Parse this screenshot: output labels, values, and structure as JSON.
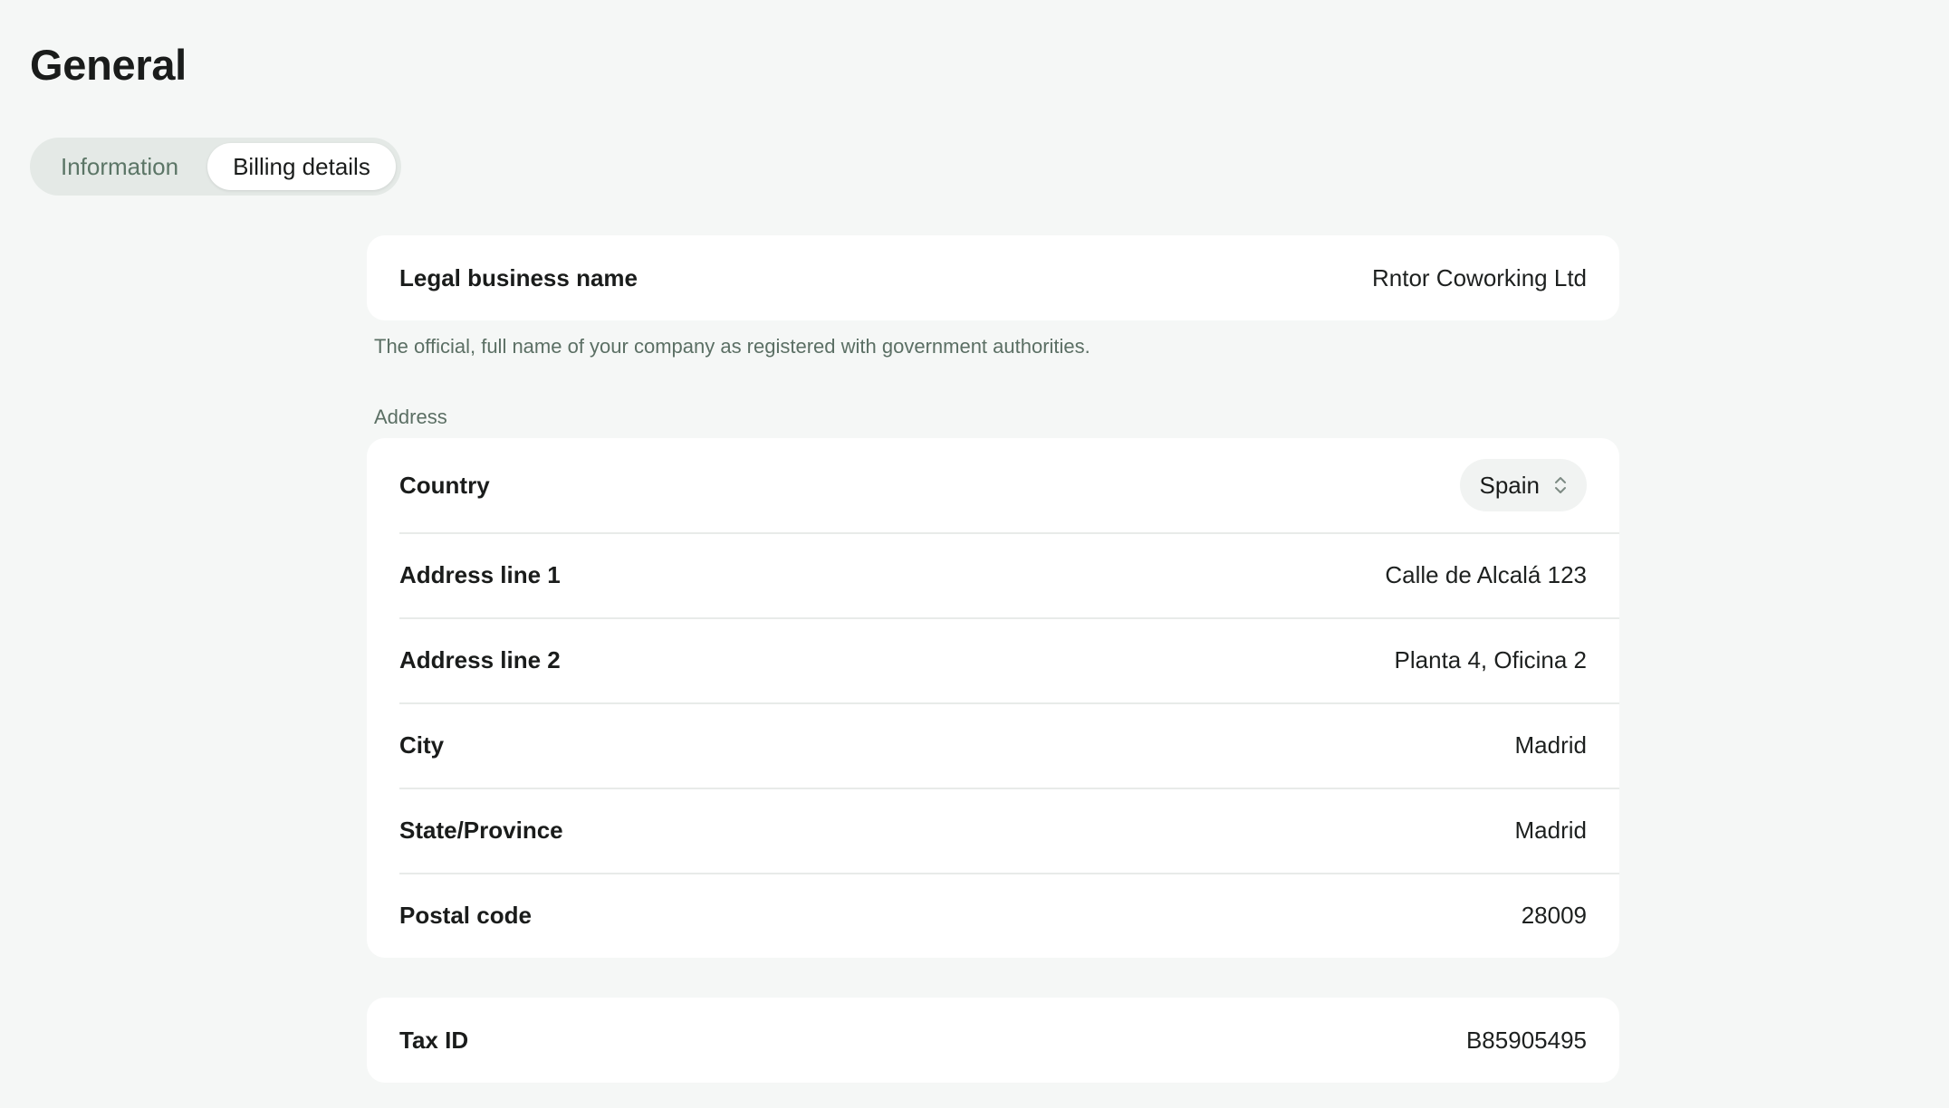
{
  "page": {
    "title": "General"
  },
  "tabs": [
    {
      "label": "Information",
      "active": false
    },
    {
      "label": "Billing details",
      "active": true
    }
  ],
  "legal": {
    "label": "Legal business name",
    "value": "Rntor Coworking Ltd",
    "helper": "The official, full name of your company as registered with government authorities."
  },
  "address": {
    "section_label": "Address",
    "country": {
      "label": "Country",
      "value": "Spain",
      "icon": "chevron-up-down-icon"
    },
    "line1": {
      "label": "Address line 1",
      "value": "Calle de Alcalá 123"
    },
    "line2": {
      "label": "Address line 2",
      "value": "Planta 4, Oficina 2"
    },
    "city": {
      "label": "City",
      "value": "Madrid"
    },
    "state": {
      "label": "State/Province",
      "value": "Madrid"
    },
    "postal": {
      "label": "Postal code",
      "value": "28009"
    }
  },
  "tax": {
    "label": "Tax ID",
    "value": "B85905495"
  },
  "colors": {
    "background": "#f5f7f6",
    "card": "#ffffff",
    "muted_text": "#5b6f64",
    "tab_inactive": "#5b7566"
  }
}
